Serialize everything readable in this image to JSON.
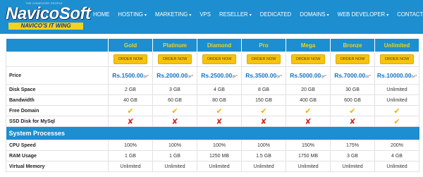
{
  "header": {
    "logo_tagline": "THE COMPUTER PEOPLE",
    "logo_name": "NavicoSoft",
    "logo_sub": "NAVICO'S IT WING"
  },
  "nav": [
    {
      "label": "HOME",
      "caret": ""
    },
    {
      "label": "HOSTING",
      "caret": "▾"
    },
    {
      "label": "MARKETING",
      "caret": "▾"
    },
    {
      "label": "VPS",
      "caret": ""
    },
    {
      "label": "RESELLER",
      "caret": "▾"
    },
    {
      "label": "DEDICATED",
      "caret": ""
    },
    {
      "label": "DOMAINS",
      "caret": "▾"
    },
    {
      "label": "WEB DEVELOPER",
      "caret": "▾"
    },
    {
      "label": "CONTACT",
      "caret": ""
    }
  ],
  "plans": [
    "Gold",
    "Platinum",
    "Diamond",
    "Pro",
    "Mega",
    "Bronze",
    "Unlimited"
  ],
  "order_label": "ORDER NOW",
  "price_row": {
    "label": "Price",
    "values": [
      "Rs.1500.00",
      "Rs.2000.00",
      "Rs.2500.00",
      "Rs.3500.00",
      "Rs.5000.00",
      "Rs.7000.00",
      "Rs.10000.00"
    ],
    "per": "/yr*"
  },
  "rows1": [
    {
      "label": "Disk Space",
      "values": [
        "2 GB",
        "3 GB",
        "4 GB",
        "8 GB",
        "20 GB",
        "30 GB",
        "Unlimited"
      ]
    },
    {
      "label": "Bandwidth",
      "values": [
        "40 GB",
        "60 GB",
        "80 GB",
        "150 GB",
        "400 GB",
        "600 GB",
        "Unlimited"
      ]
    }
  ],
  "free_domain": {
    "label": "Free Domain",
    "values": [
      "check",
      "check",
      "check",
      "check",
      "check",
      "check",
      "check"
    ]
  },
  "ssd_disk": {
    "label": "SSD Disk for MySql",
    "values": [
      "cross",
      "cross",
      "cross",
      "cross",
      "cross",
      "cross",
      "check"
    ]
  },
  "section_title": "System Processes",
  "rows2": [
    {
      "label": "CPU Speed",
      "values": [
        "100%",
        "100%",
        "100%",
        "100%",
        "150%",
        "175%",
        "200%"
      ]
    },
    {
      "label": "RAM Usage",
      "values": [
        "1 GB",
        "1 GB",
        "1250 MB",
        "1.5 GB",
        "1750 MB",
        "3 GB",
        "4 GB"
      ]
    },
    {
      "label": "Virtual Memory",
      "values": [
        "Unlimited",
        "Unlimited",
        "Unlimited",
        "Unlimited",
        "Unlimited",
        "Unlimited",
        "Unlimited"
      ]
    }
  ],
  "symbols": {
    "check": "✔",
    "cross": "✘"
  }
}
